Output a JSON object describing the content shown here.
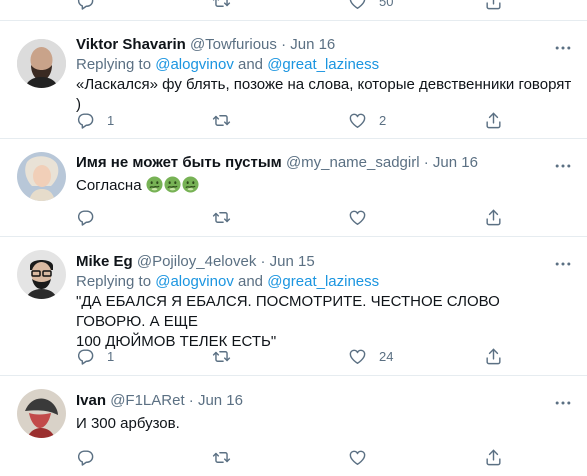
{
  "top_counts": {
    "like": "50"
  },
  "tweets": [
    {
      "name": "Viktor Shavarin",
      "handle": "@Towfurious",
      "sep": "·",
      "date": "Jun 16",
      "replying_prefix": "Replying to ",
      "mention1": "@alogvinov",
      "and": " and ",
      "mention2": "@great_laziness",
      "text": "«Ласкался» фу блять, позоже на слова, которые девственники говорят )",
      "reply_count": "1",
      "retweet_count": "",
      "like_count": "2"
    },
    {
      "name": "Имя не может быть пустым",
      "handle": "@my_name_sadgirl",
      "sep": "·",
      "date": "Jun 16",
      "text": "Согласна",
      "emojis": [
        "nauseated-face",
        "nauseated-face",
        "nauseated-face"
      ],
      "reply_count": "",
      "retweet_count": "",
      "like_count": ""
    },
    {
      "name": "Mike Eg",
      "handle": "@Pojiloy_4elovek",
      "sep": "·",
      "date": "Jun 15",
      "replying_prefix": "Replying to ",
      "mention1": "@alogvinov",
      "and": " and ",
      "mention2": "@great_laziness",
      "text_line1": "\"ДА ЕБАЛСЯ Я ЕБАЛСЯ. ПОСМОТРИТЕ. ЧЕСТНОЕ СЛОВО ГОВОРЮ. А ЕЩЕ",
      "text_line2": "100 ДЮЙМОВ ТЕЛЕК ЕСТЬ\"",
      "reply_count": "1",
      "retweet_count": "",
      "like_count": "24"
    },
    {
      "name": "Ivan",
      "handle": "@F1LARet",
      "sep": "·",
      "date": "Jun 16",
      "text": "И 300 арбузов.",
      "reply_count": "",
      "retweet_count": "",
      "like_count": ""
    }
  ],
  "colors": {
    "secondary": "#5b7083",
    "link": "#1b95e0",
    "border": "#e6ecf0"
  },
  "icons": [
    "reply-icon",
    "retweet-icon",
    "like-icon",
    "share-icon",
    "more-icon"
  ]
}
